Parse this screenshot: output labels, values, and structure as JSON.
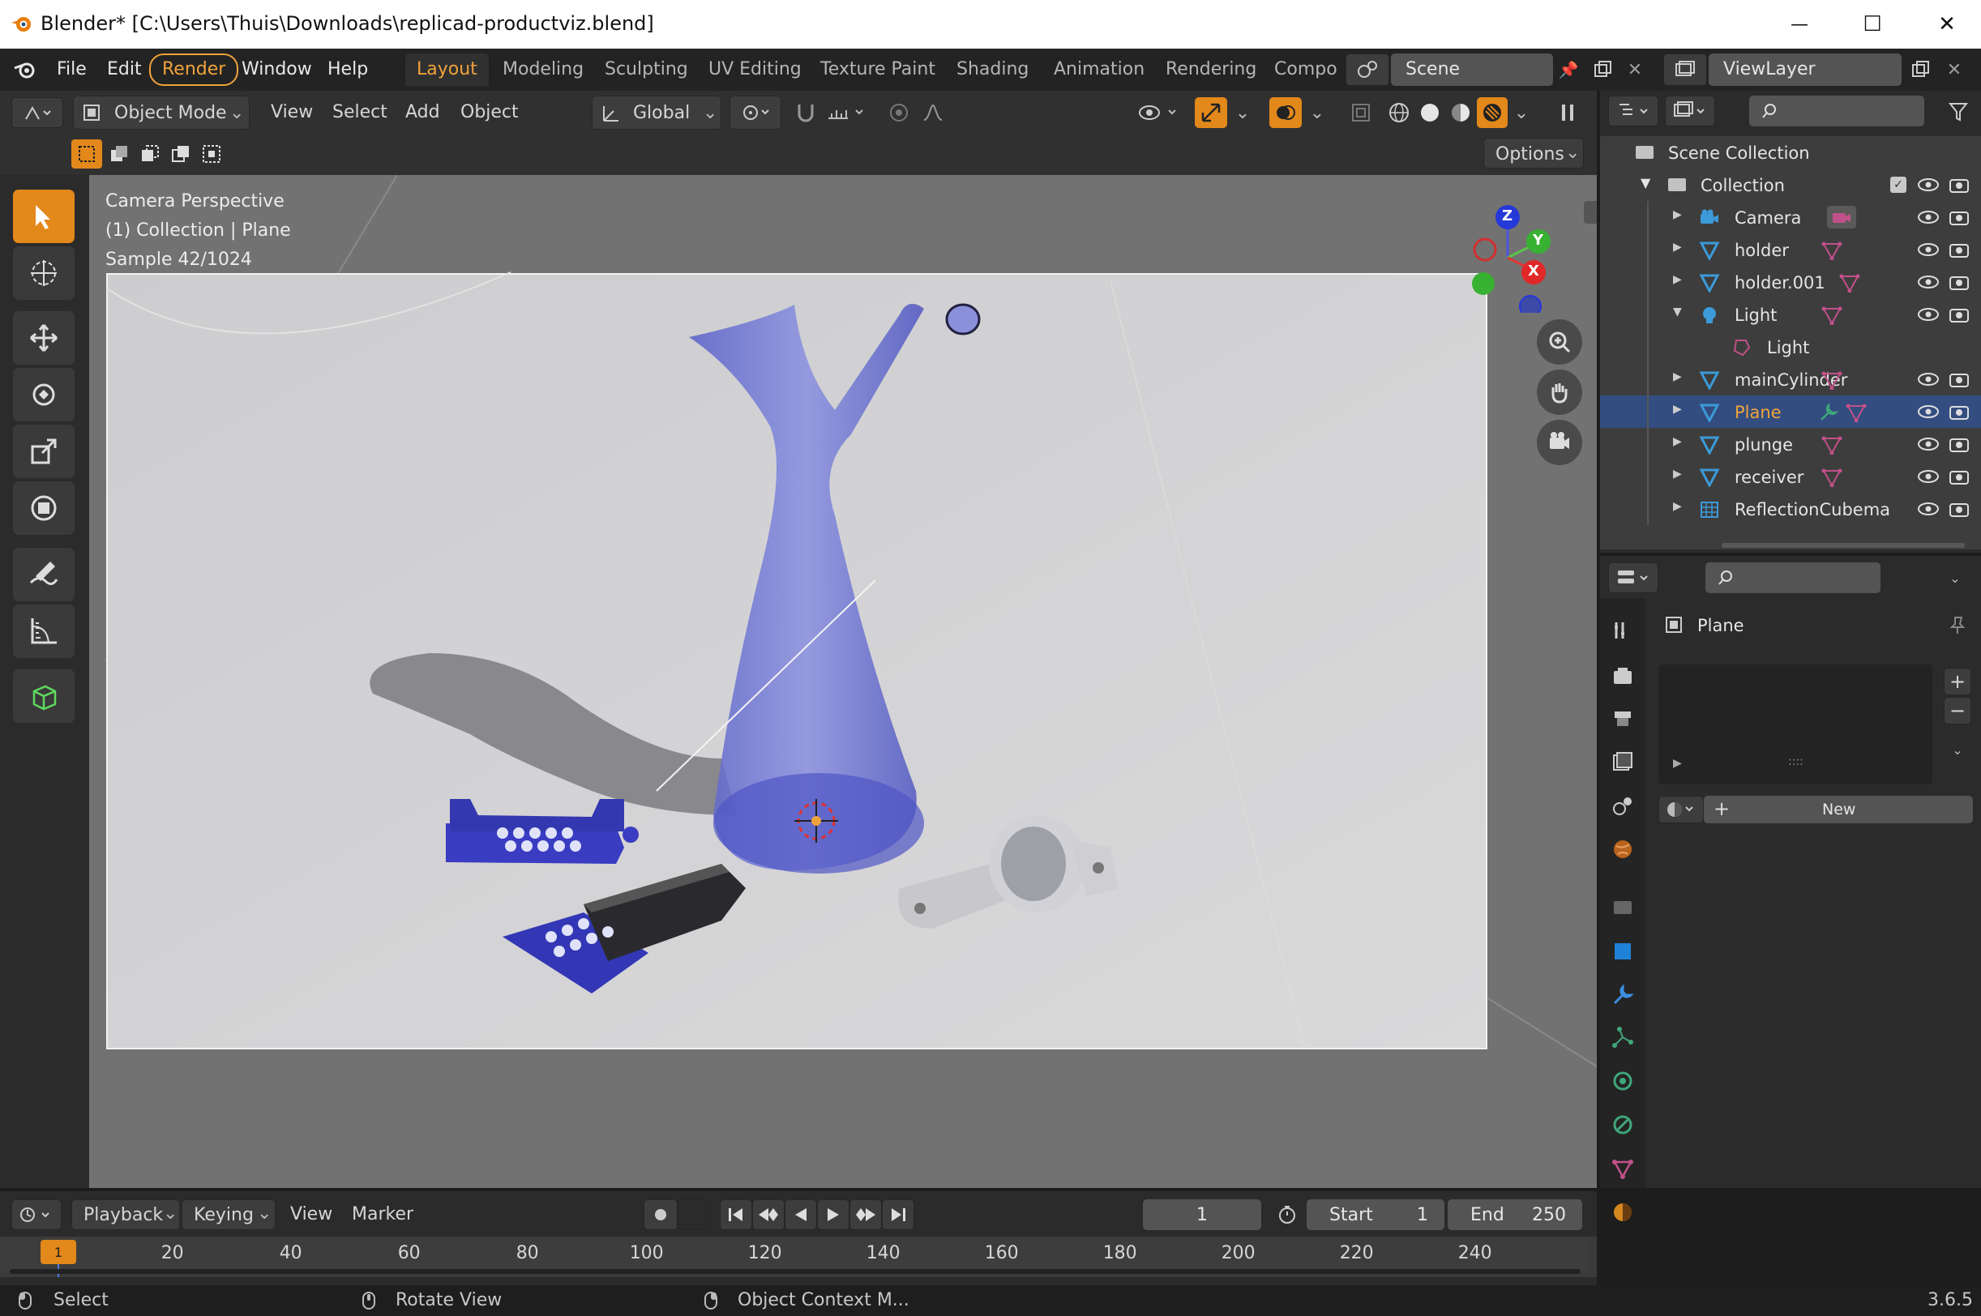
{
  "window": {
    "title": "Blender* [C:\\Users\\Thuis\\Downloads\\replicad-productviz.blend]",
    "controls": {
      "minimize": "—",
      "maximize": "☐",
      "close": "✕"
    }
  },
  "menu": {
    "items": [
      "File",
      "Edit",
      "Render",
      "Window",
      "Help"
    ],
    "workspaces": [
      "Layout",
      "Modeling",
      "Sculpting",
      "UV Editing",
      "Texture Paint",
      "Shading",
      "Animation",
      "Rendering",
      "Compo"
    ],
    "active_workspace": "Layout",
    "scene": "Scene",
    "view_layer": "ViewLayer"
  },
  "header": {
    "mode": "Object Mode",
    "menus": [
      "View",
      "Select",
      "Add",
      "Object"
    ],
    "transform_orientation": "Global",
    "options_label": "Options"
  },
  "viewport": {
    "info_line1": "Camera Perspective",
    "info_line2": "(1) Collection | Plane",
    "info_line3": "Sample 42/1024",
    "gizmo": {
      "x": "X",
      "y": "Y",
      "z": "Z"
    }
  },
  "outliner": {
    "root": "Scene Collection",
    "collection": "Collection",
    "items": [
      {
        "name": "Camera",
        "type": "camera"
      },
      {
        "name": "holder",
        "type": "mesh"
      },
      {
        "name": "holder.001",
        "type": "mesh"
      },
      {
        "name": "Light",
        "type": "light"
      },
      {
        "name": "Light",
        "type": "light-data"
      },
      {
        "name": "mainCylinder",
        "type": "mesh"
      },
      {
        "name": "Plane",
        "type": "mesh",
        "selected": true
      },
      {
        "name": "plunge",
        "type": "mesh"
      },
      {
        "name": "receiver",
        "type": "mesh"
      },
      {
        "name": "ReflectionCubema",
        "type": "probe"
      }
    ]
  },
  "properties": {
    "object_name": "Plane",
    "new_label": "New"
  },
  "timeline": {
    "menus": [
      "Playback",
      "Keying",
      "View",
      "Marker"
    ],
    "current_frame": "1",
    "start_label": "Start",
    "start_value": "1",
    "end_label": "End",
    "end_value": "250",
    "ruler": [
      "1",
      "20",
      "40",
      "60",
      "80",
      "100",
      "120",
      "140",
      "160",
      "180",
      "200",
      "220",
      "240"
    ]
  },
  "status": {
    "select": "Select",
    "rotate": "Rotate View",
    "context": "Object Context M...",
    "version": "3.6.5"
  },
  "colors": {
    "accent": "#f0a33b",
    "active_tool": "#e3881a",
    "selected_row": "#334d80",
    "object_blue": "#4a63d6"
  }
}
